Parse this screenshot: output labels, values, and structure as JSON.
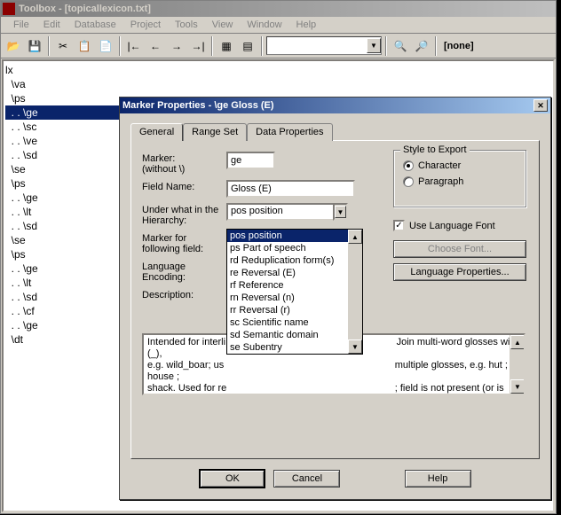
{
  "app_title": "Toolbox - [topicallexicon.txt]",
  "menu": [
    "File",
    "Edit",
    "Database",
    "Project",
    "Tools",
    "View",
    "Window",
    "Help"
  ],
  "toolbar": {
    "none_label": "[none]"
  },
  "tree": [
    {
      "t": "lx",
      "i": 0
    },
    {
      "t": "\\va",
      "i": 1
    },
    {
      "t": "\\ps",
      "i": 1
    },
    {
      "t": ". . \\ge",
      "i": 1,
      "sel": true
    },
    {
      "t": ". . \\sc",
      "i": 1
    },
    {
      "t": ". . \\ve",
      "i": 1
    },
    {
      "t": ". . \\sd",
      "i": 1
    },
    {
      "t": "\\se",
      "i": 1
    },
    {
      "t": "\\ps",
      "i": 1
    },
    {
      "t": ". . \\ge",
      "i": 1
    },
    {
      "t": ". . \\lt",
      "i": 1
    },
    {
      "t": ". . \\sd",
      "i": 1
    },
    {
      "t": "\\se",
      "i": 1
    },
    {
      "t": "\\ps",
      "i": 1
    },
    {
      "t": ". . \\ge",
      "i": 1
    },
    {
      "t": ". . \\lt",
      "i": 1
    },
    {
      "t": ". . \\sd",
      "i": 1
    },
    {
      "t": ". . \\cf",
      "i": 1
    },
    {
      "t": ". . \\ge",
      "i": 1
    },
    {
      "t": "\\dt",
      "i": 1
    }
  ],
  "dialog": {
    "title": "Marker Properties - \\ge Gloss (E)",
    "tabs": [
      "General",
      "Range Set",
      "Data Properties"
    ],
    "marker_lbl": "Marker:\n(without \\)",
    "marker_val": "ge",
    "fieldname_lbl": "Field Name:",
    "fieldname_val": "Gloss (E)",
    "hierarchy_lbl": "Under what in the Hierarchy:",
    "hierarchy_val": "pos  position",
    "following_lbl": "Marker for following field:",
    "encoding_lbl": "Language Encoding:",
    "desc_lbl": "Description:",
    "dropdown_items": [
      "pos  position",
      "ps  Part of speech",
      "rd  Reduplication form(s)",
      "re  Reversal (E)",
      "rf  Reference",
      "rn  Reversal (n)",
      "rr  Reversal (r)",
      "sc  Scientific name",
      "sd  Semantic domain",
      "se  Subentry"
    ],
    "desc_text": "Intended for interli                                                               Join multi-word glosses with (_),\ne.g. wild_boar; us                                                               multiple glosses, e.g. hut ; house ;\nshack. Used for re                                                              ; field is not present (or is present\nbut empty); also as an English definition in a formatted dictionary if there is no \\de",
    "style_legend": "Style to Export",
    "radio_char": "Character",
    "radio_para": "Paragraph",
    "cb_langfont": "Use Language Font",
    "btn_font": "Choose Font...",
    "btn_langprop": "Language Properties...",
    "btn_ok": "OK",
    "btn_cancel": "Cancel",
    "btn_help": "Help"
  }
}
